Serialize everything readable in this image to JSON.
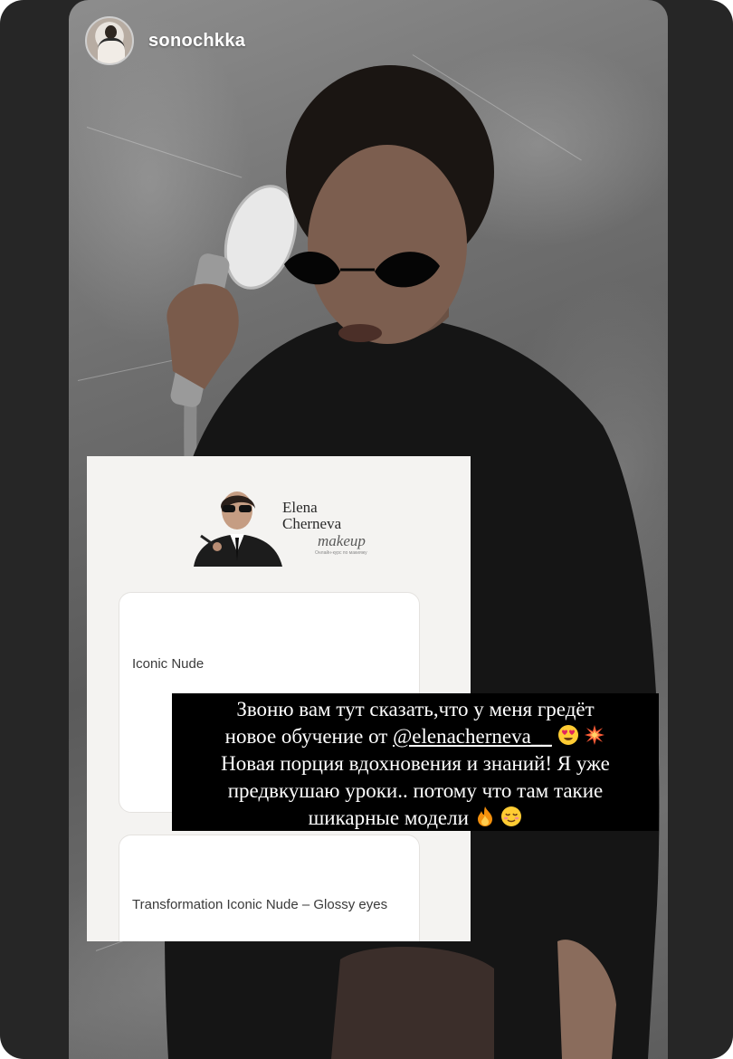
{
  "story": {
    "username": "sonochkka"
  },
  "card": {
    "brand": {
      "name_line1": "Elena",
      "name_line2": "Cherneva",
      "subtitle": "makeup",
      "tagline": "Онлайн-курс по макияжу"
    },
    "courses": [
      {
        "title": "Iconic Nude"
      },
      {
        "title": "Transformation Iconic Nude – Glossy eyes"
      }
    ]
  },
  "caption": {
    "line1": "Звоню вам тут сказать,что у меня гредёт",
    "line2_prefix": "новое обучение от ",
    "mention": "@elenacherneva__",
    "line3": "Новая порция вдохновения и знаний! Я уже",
    "line4": "предвкушаю уроки.. потому что там такие",
    "line5": "шикарные модели",
    "emojis": [
      "heart-eyes-emoji",
      "collision-emoji",
      "fire-emoji",
      "relieved-emoji"
    ]
  },
  "colors": {
    "frame": "#262626",
    "caption_bg": "#000000",
    "card_bg": "#f4f3f1"
  }
}
